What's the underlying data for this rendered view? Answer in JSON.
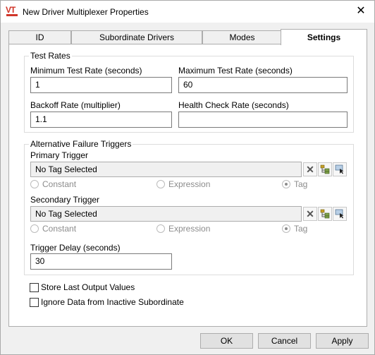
{
  "window": {
    "title": "New Driver Multiplexer Properties",
    "icon_text": "VT",
    "close_glyph": "✕"
  },
  "tabs": [
    {
      "label": "ID",
      "active": false
    },
    {
      "label": "Subordinate Drivers",
      "active": false
    },
    {
      "label": "Modes",
      "active": false
    },
    {
      "label": "Settings",
      "active": true
    }
  ],
  "test_rates": {
    "legend": "Test Rates",
    "min_label": "Minimum Test Rate (seconds)",
    "min_value": "1",
    "max_label": "Maximum Test Rate (seconds)",
    "max_value": "60",
    "backoff_label": "Backoff Rate (multiplier)",
    "backoff_value": "1.1",
    "health_label": "Health Check Rate (seconds)",
    "health_value": ""
  },
  "failure_triggers": {
    "legend": "Alternative Failure Triggers",
    "primary": {
      "label": "Primary Trigger",
      "value": "No Tag Selected",
      "options": [
        "Constant",
        "Expression",
        "Tag"
      ],
      "selected": "Tag"
    },
    "secondary": {
      "label": "Secondary Trigger",
      "value": "No Tag Selected",
      "options": [
        "Constant",
        "Expression",
        "Tag"
      ],
      "selected": "Tag"
    },
    "delay_label": "Trigger Delay (seconds)",
    "delay_value": "30"
  },
  "options": {
    "store_last": {
      "label": "Store Last Output Values",
      "checked": false
    },
    "ignore_inactive": {
      "label": "Ignore Data from Inactive Subordinate",
      "checked": false
    }
  },
  "buttons": {
    "ok": "OK",
    "cancel": "Cancel",
    "apply": "Apply"
  },
  "colors": {
    "brand": "#d0362a",
    "tree_icon": "#6b8e23"
  }
}
